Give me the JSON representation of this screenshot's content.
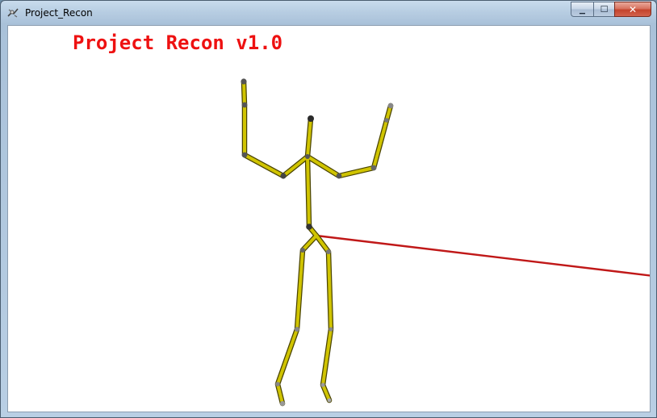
{
  "window": {
    "title": "Project_Recon"
  },
  "controls": {
    "minimize_glyph": "▁",
    "maximize_glyph": "☐",
    "close_glyph": "✕"
  },
  "viewport": {
    "overlay_title": "Project Recon v1.0",
    "overlay_color": "#ee1111",
    "background": "#ffffff",
    "skeleton_color": "#c9bc00",
    "ray_color": "#c01818"
  }
}
